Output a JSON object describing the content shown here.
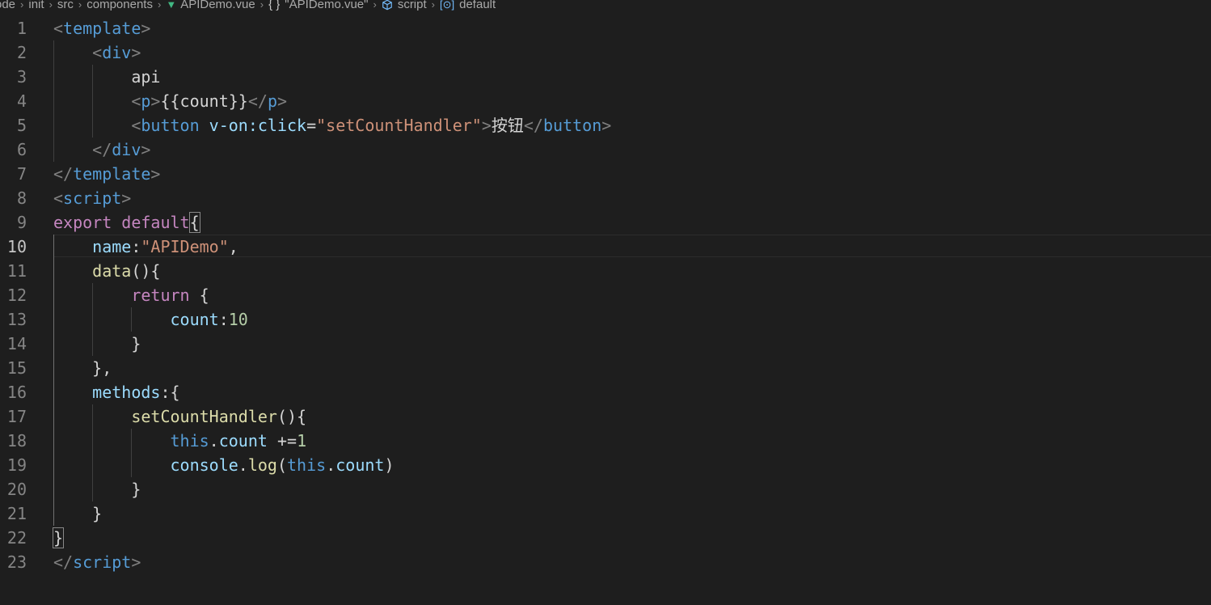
{
  "breadcrumb": {
    "items": [
      {
        "label": "ode",
        "icon": null
      },
      {
        "label": "init",
        "icon": null
      },
      {
        "label": "src",
        "icon": null
      },
      {
        "label": "components",
        "icon": null
      },
      {
        "label": "APIDemo.vue",
        "icon": "vue-icon"
      },
      {
        "label": "\"APIDemo.vue\"",
        "icon": "braces-icon"
      },
      {
        "label": "script",
        "icon": "cube-icon"
      },
      {
        "label": "default",
        "icon": "bracket-icon"
      }
    ]
  },
  "editor": {
    "active_line": 10,
    "lines": [
      {
        "n": "1",
        "tokens": [
          [
            "punct",
            "<"
          ],
          [
            "tag",
            "template"
          ],
          [
            "punct",
            ">"
          ]
        ]
      },
      {
        "n": "2",
        "tokens": [
          [
            "text",
            "    "
          ],
          [
            "punct",
            "<"
          ],
          [
            "tag",
            "div"
          ],
          [
            "punct",
            ">"
          ]
        ]
      },
      {
        "n": "3",
        "tokens": [
          [
            "text",
            "        api"
          ]
        ]
      },
      {
        "n": "4",
        "tokens": [
          [
            "text",
            "        "
          ],
          [
            "punct",
            "<"
          ],
          [
            "tag",
            "p"
          ],
          [
            "punct",
            ">"
          ],
          [
            "text",
            "{{count}}"
          ],
          [
            "punct",
            "</"
          ],
          [
            "tag",
            "p"
          ],
          [
            "punct",
            ">"
          ]
        ]
      },
      {
        "n": "5",
        "tokens": [
          [
            "text",
            "        "
          ],
          [
            "punct",
            "<"
          ],
          [
            "tag",
            "button"
          ],
          [
            "text",
            " "
          ],
          [
            "attr",
            "v-on:click"
          ],
          [
            "text",
            "="
          ],
          [
            "str",
            "\"setCountHandler\""
          ],
          [
            "punct",
            ">"
          ],
          [
            "text",
            "按钮"
          ],
          [
            "punct",
            "</"
          ],
          [
            "tag",
            "button"
          ],
          [
            "punct",
            ">"
          ]
        ]
      },
      {
        "n": "6",
        "tokens": [
          [
            "text",
            "    "
          ],
          [
            "punct",
            "</"
          ],
          [
            "tag",
            "div"
          ],
          [
            "punct",
            ">"
          ]
        ]
      },
      {
        "n": "7",
        "tokens": [
          [
            "punct",
            "</"
          ],
          [
            "tag",
            "template"
          ],
          [
            "punct",
            ">"
          ]
        ]
      },
      {
        "n": "8",
        "tokens": [
          [
            "punct",
            "<"
          ],
          [
            "tag",
            "script"
          ],
          [
            "punct",
            ">"
          ]
        ]
      },
      {
        "n": "9",
        "tokens": [
          [
            "kw",
            "export"
          ],
          [
            "text",
            " "
          ],
          [
            "kw",
            "default"
          ],
          [
            "brace",
            "{"
          ]
        ]
      },
      {
        "n": "10",
        "tokens": [
          [
            "text",
            "    "
          ],
          [
            "attr",
            "name"
          ],
          [
            "text",
            ":"
          ],
          [
            "str",
            "\"APIDemo\""
          ],
          [
            "text",
            ","
          ]
        ]
      },
      {
        "n": "11",
        "tokens": [
          [
            "text",
            "    "
          ],
          [
            "fn",
            "data"
          ],
          [
            "text",
            "(){"
          ]
        ]
      },
      {
        "n": "12",
        "tokens": [
          [
            "text",
            "        "
          ],
          [
            "kw",
            "return"
          ],
          [
            "text",
            " {"
          ]
        ]
      },
      {
        "n": "13",
        "tokens": [
          [
            "text",
            "            "
          ],
          [
            "attr",
            "count"
          ],
          [
            "text",
            ":"
          ],
          [
            "num",
            "10"
          ]
        ]
      },
      {
        "n": "14",
        "tokens": [
          [
            "text",
            "        }"
          ]
        ]
      },
      {
        "n": "15",
        "tokens": [
          [
            "text",
            "    },"
          ]
        ]
      },
      {
        "n": "16",
        "tokens": [
          [
            "text",
            "    "
          ],
          [
            "attr",
            "methods"
          ],
          [
            "text",
            ":{"
          ]
        ]
      },
      {
        "n": "17",
        "tokens": [
          [
            "text",
            "        "
          ],
          [
            "fn",
            "setCountHandler"
          ],
          [
            "text",
            "(){"
          ]
        ]
      },
      {
        "n": "18",
        "tokens": [
          [
            "text",
            "            "
          ],
          [
            "tag",
            "this"
          ],
          [
            "text",
            "."
          ],
          [
            "attr",
            "count"
          ],
          [
            "text",
            " +="
          ],
          [
            "num",
            "1"
          ]
        ]
      },
      {
        "n": "19",
        "tokens": [
          [
            "text",
            "            "
          ],
          [
            "attr",
            "console"
          ],
          [
            "text",
            "."
          ],
          [
            "fn",
            "log"
          ],
          [
            "text",
            "("
          ],
          [
            "tag",
            "this"
          ],
          [
            "text",
            "."
          ],
          [
            "attr",
            "count"
          ],
          [
            "text",
            ")"
          ]
        ]
      },
      {
        "n": "20",
        "tokens": [
          [
            "text",
            "        }"
          ]
        ]
      },
      {
        "n": "21",
        "tokens": [
          [
            "text",
            "    }"
          ]
        ]
      },
      {
        "n": "22",
        "tokens": [
          [
            "brace",
            "}"
          ]
        ]
      },
      {
        "n": "23",
        "tokens": [
          [
            "punct",
            "</"
          ],
          [
            "tag",
            "script"
          ],
          [
            "punct",
            ">"
          ]
        ]
      }
    ]
  }
}
